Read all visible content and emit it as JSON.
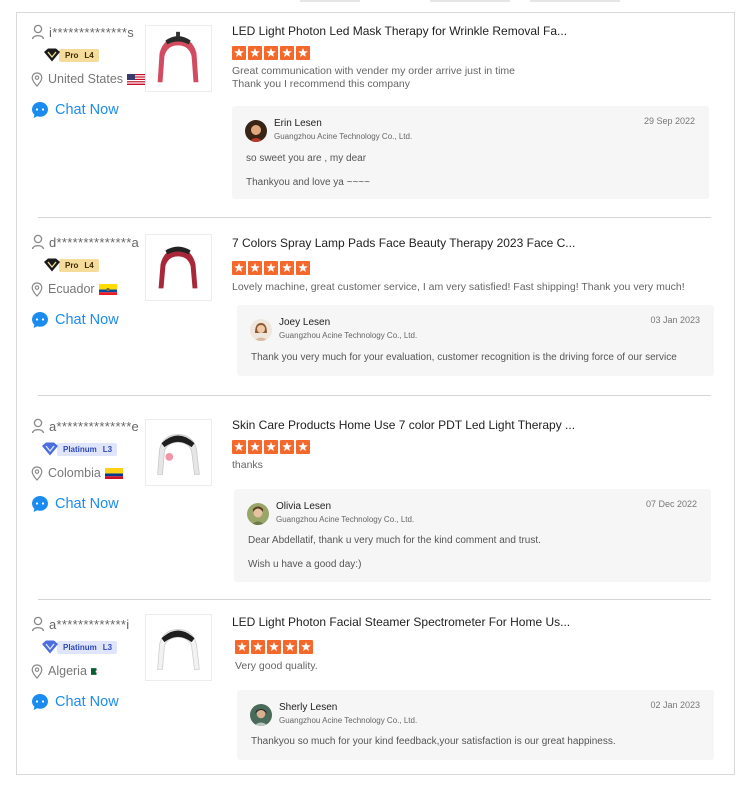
{
  "reviews": [
    {
      "buyer_name": "i**************s",
      "badge": "Pro",
      "level": "L4",
      "country": "United States",
      "chat_label": "Chat Now",
      "product_title": "LED Light Photon Led Mask Therapy for Wrinkle Removal Fa...",
      "rating": 5,
      "comment_lines": [
        "Great communication with vender my order arrive just in time",
        "Thank you I recommend this company"
      ],
      "reply": {
        "name": "Erin Lesen",
        "company": "Guangzhou Acine Technology Co., Ltd.",
        "date": "29 Sep 2022",
        "lines": [
          "so sweet you are , my dear",
          "Thankyou and love ya ~~~~"
        ]
      }
    },
    {
      "buyer_name": "d**************a",
      "badge": "Pro",
      "level": "L4",
      "country": "Ecuador",
      "chat_label": "Chat Now",
      "product_title": "7 Colors Spray Lamp Pads Face Beauty Therapy 2023 Face C...",
      "rating": 5,
      "comment_lines": [
        "Lovely machine, great customer service, I am very satisfied! Fast shipping! Thank you very much!"
      ],
      "reply": {
        "name": "Joey Lesen",
        "company": "Guangzhou Acine Technology Co., Ltd.",
        "date": "03 Jan 2023",
        "lines": [
          "Thank you very much for your evaluation, customer recognition is the driving force of our service"
        ]
      }
    },
    {
      "buyer_name": "a**************e",
      "badge": "Platinum",
      "level": "L3",
      "country": "Colombia",
      "chat_label": "Chat Now",
      "product_title": "Skin Care Products Home Use 7 color PDT Led Light Therapy ...",
      "rating": 5,
      "comment_lines": [
        "thanks"
      ],
      "reply": {
        "name": "Olivia Lesen",
        "company": "Guangzhou Acine Technology Co., Ltd.",
        "date": "07 Dec 2022",
        "lines": [
          "Dear Abdellatif, thank u very much for the kind comment and trust.",
          "Wish u have a good day:)"
        ]
      }
    },
    {
      "buyer_name": "a*************i",
      "badge": "Platinum",
      "level": "L3",
      "country": "Algeria",
      "chat_label": "Chat Now",
      "product_title": "LED Light Photon Facial Steamer Spectrometer For Home Us...",
      "rating": 5,
      "comment_lines": [
        "Very good quality."
      ],
      "reply": {
        "name": "Sherly Lesen",
        "company": "Guangzhou Acine Technology Co., Ltd.",
        "date": "02 Jan 2023",
        "lines": [
          "Thankyou so much for your kind feedback,your satisfaction is our great happiness."
        ]
      }
    }
  ],
  "colors": {
    "star": "#f5682c",
    "chat": "#1a8cf0",
    "pro_badge": "#f5dc9b",
    "platinum_badge": "#dfe6fb"
  }
}
